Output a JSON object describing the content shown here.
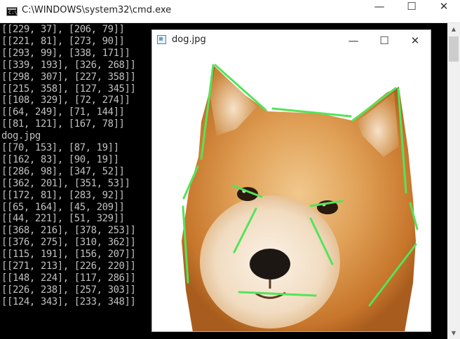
{
  "cmd_window": {
    "title": "C:\\WINDOWS\\system32\\cmd.exe",
    "icon_glyph": "C:\\",
    "minimize": "—",
    "maximize": "☐",
    "close": "✕",
    "lines": [
      "[[229, 37], [206, 79]]",
      "[[221, 81], [273, 90]]",
      "[[293, 99], [338, 171]]",
      "[[339, 193], [326, 268]]",
      "[[298, 307], [227, 358]]",
      "[[215, 358], [127, 345]]",
      "[[108, 329], [72, 274]]",
      "[[64, 249], [71, 144]]",
      "[[81, 121], [167, 78]]",
      "dog.jpg",
      "[[70, 153], [87, 19]]",
      "[[162, 83], [90, 19]]",
      "[[286, 98], [347, 52]]",
      "[[362, 201], [351, 53]]",
      "[[172, 81], [283, 92]]",
      "[[65, 164], [45, 209]]",
      "[[44, 221], [51, 329]]",
      "[[368, 216], [378, 253]]",
      "[[376, 275], [310, 362]]",
      "[[115, 191], [156, 207]]",
      "[[271, 213], [226, 220]]",
      "[[148, 224], [117, 286]]",
      "[[226, 238], [257, 303]]",
      "[[124, 343], [233, 348]]"
    ]
  },
  "image_window": {
    "title": "dog.jpg",
    "minimize": "—",
    "maximize": "☐",
    "close": "✕",
    "overlay_color": "#55e35a",
    "segments": [
      [
        [
          70,
          153
        ],
        [
          87,
          19
        ]
      ],
      [
        [
          162,
          83
        ],
        [
          90,
          19
        ]
      ],
      [
        [
          286,
          98
        ],
        [
          347,
          52
        ]
      ],
      [
        [
          362,
          201
        ],
        [
          351,
          53
        ]
      ],
      [
        [
          172,
          81
        ],
        [
          283,
          92
        ]
      ],
      [
        [
          65,
          164
        ],
        [
          45,
          209
        ]
      ],
      [
        [
          44,
          221
        ],
        [
          51,
          329
        ]
      ],
      [
        [
          368,
          216
        ],
        [
          378,
          253
        ]
      ],
      [
        [
          376,
          275
        ],
        [
          310,
          362
        ]
      ],
      [
        [
          115,
          191
        ],
        [
          156,
          207
        ]
      ],
      [
        [
          271,
          213
        ],
        [
          226,
          220
        ]
      ],
      [
        [
          148,
          224
        ],
        [
          117,
          286
        ]
      ],
      [
        [
          226,
          238
        ],
        [
          257,
          303
        ]
      ],
      [
        [
          124,
          343
        ],
        [
          233,
          348
        ]
      ]
    ]
  }
}
